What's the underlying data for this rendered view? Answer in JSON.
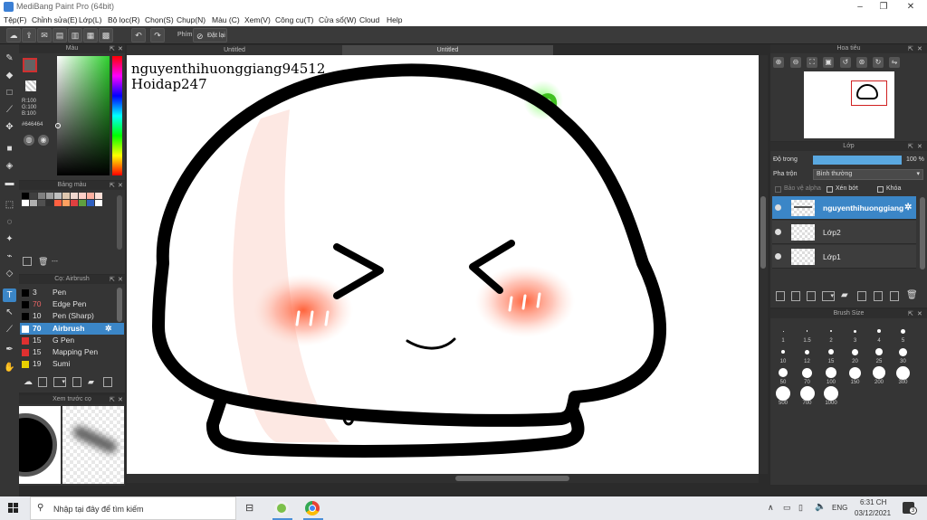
{
  "window": {
    "title": "MediBang Paint Pro (64bit)"
  },
  "menu": [
    "Tệp(F)",
    "Chỉnh sửa(E)",
    "Lớp(L)",
    "Bộ lọc(R)",
    "Chọn(S)",
    "Chụp(N)",
    "Màu (C)",
    "Xem(V)",
    "Công cụ(T)",
    "Cửa sổ(W)",
    "Cloud",
    "Help"
  ],
  "toolbar": {
    "snap_label": "Phím",
    "reset_label": "Đặt lại"
  },
  "doc_tabs": [
    "Untitled",
    "Untitled"
  ],
  "color_panel": {
    "title": "Màu",
    "r": "R:100",
    "g": "G:100",
    "b": "B:100",
    "hex": "#646464",
    "current_color": "#646464"
  },
  "palette_panel": {
    "title": "Bảng màu",
    "swatches": [
      "#000000",
      "#404040",
      "#808080",
      "#a0a0a0",
      "#c0c0c0",
      "#e0c8b0",
      "#f0d8d0",
      "#ffd0c8",
      "#ffb0a0",
      "#ffe0d8",
      "#ffffff",
      "#b0b0b0",
      "#505050",
      "#303030",
      "#ff6040",
      "#ffa060",
      "#e04040",
      "#60a040",
      "#3060c0",
      "#ffffff"
    ],
    "footer": "---"
  },
  "brush_panel": {
    "title": "Cọ: Airbrush",
    "brushes": [
      {
        "size": "3",
        "name": "Pen",
        "color": "#000000"
      },
      {
        "size": "70",
        "name": "Edge Pen",
        "color": "#000000"
      },
      {
        "size": "10",
        "name": "Pen (Sharp)",
        "color": "#000000"
      },
      {
        "size": "70",
        "name": "Airbrush",
        "color": "#ffffff"
      },
      {
        "size": "15",
        "name": "G Pen",
        "color": "#e03030"
      },
      {
        "size": "15",
        "name": "Mapping Pen",
        "color": "#e03030"
      },
      {
        "size": "19",
        "name": "Sumi",
        "color": "#e8d000"
      }
    ]
  },
  "preview_panel": {
    "title": "Xem trước cọ"
  },
  "canvas": {
    "text_line1": "nguyenthihuonggiang94512",
    "text_line2": "Hoidap247"
  },
  "navigator_panel": {
    "title": "Hoa tiêu"
  },
  "layer_panel": {
    "title": "Lớp",
    "opacity_label": "Độ trong",
    "opacity_value": "100 %",
    "blend_label": "Pha trộn",
    "blend_value": "Bình thường",
    "protect_alpha": "Bảo vệ alpha",
    "clipping": "Xén bớt",
    "lock": "Khóa",
    "layers": [
      {
        "name": "nguyenthihuonggiang",
        "selected": true
      },
      {
        "name": "Lớp2",
        "selected": false
      },
      {
        "name": "Lớp1",
        "selected": false
      }
    ]
  },
  "brush_size_panel": {
    "title": "Brush Size",
    "sizes": [
      "1",
      "1.5",
      "2",
      "3",
      "4",
      "5",
      "10",
      "12",
      "15",
      "20",
      "25",
      "30",
      "50",
      "70",
      "100",
      "150",
      "200",
      "300",
      "500",
      "700",
      "1000"
    ]
  },
  "taskbar": {
    "search_placeholder": "Nhập tại đây để tìm kiếm",
    "lang": "ENG",
    "time": "6:31 CH",
    "date": "03/12/2021",
    "notif_count": "3"
  }
}
